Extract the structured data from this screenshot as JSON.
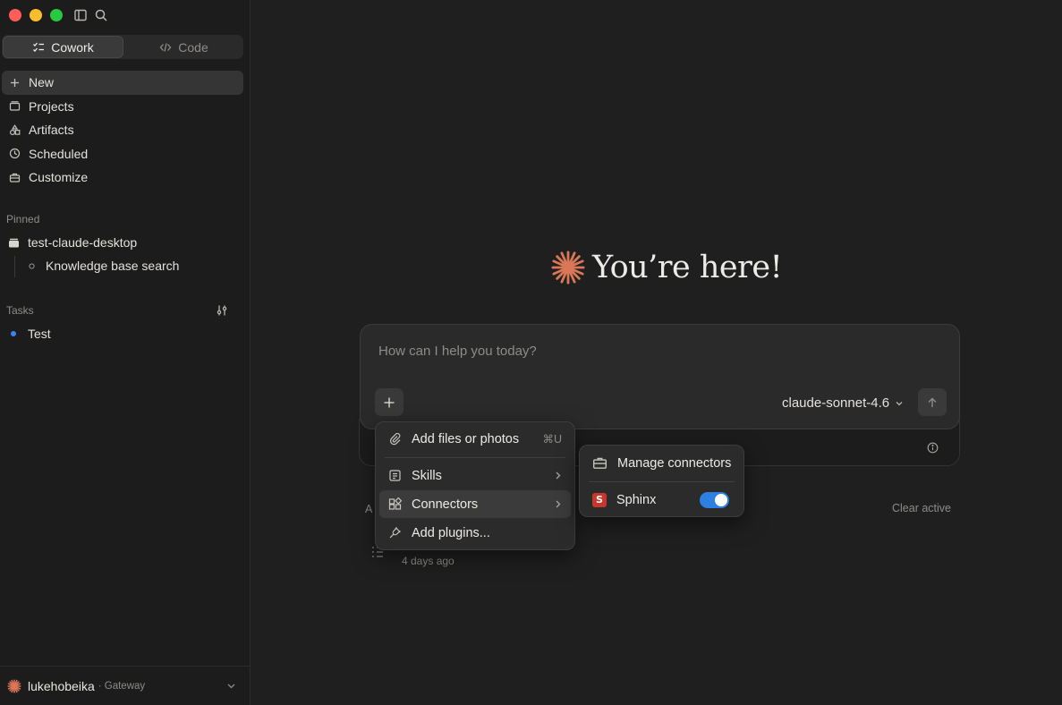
{
  "sidebar": {
    "modes": [
      {
        "label": "Cowork",
        "active": true
      },
      {
        "label": "Code",
        "active": false
      }
    ],
    "nav": [
      {
        "label": "New",
        "icon": "plus-icon"
      },
      {
        "label": "Projects",
        "icon": "folder-icon"
      },
      {
        "label": "Artifacts",
        "icon": "shapes-icon"
      },
      {
        "label": "Scheduled",
        "icon": "clock-icon"
      },
      {
        "label": "Customize",
        "icon": "briefcase-icon"
      }
    ],
    "pinned_label": "Pinned",
    "pinned": {
      "project": "test-claude-desktop",
      "child": "Knowledge base search"
    },
    "tasks_label": "Tasks",
    "tasks": [
      {
        "label": "Test",
        "status_color": "#3b82f6"
      }
    ],
    "account": {
      "name": "lukehobeika",
      "sub": "· Gateway"
    }
  },
  "main": {
    "greeting": "You’re here!",
    "accent_color": "#d97757",
    "composer": {
      "placeholder": "How can I help you today?",
      "model": "claude-sonnet-4.6"
    },
    "a_label": "A",
    "clear_active": "Clear active",
    "task_time": "4 days ago"
  },
  "menu": {
    "items": [
      {
        "label": "Add files or photos",
        "shortcut": "⌘U",
        "icon": "paperclip-icon"
      },
      {
        "label": "Skills",
        "icon": "skills-icon"
      },
      {
        "label": "Connectors",
        "icon": "connectors-icon",
        "highlighted": true
      },
      {
        "label": "Add plugins...",
        "icon": "plug-icon"
      }
    ]
  },
  "submenu": {
    "manage": "Manage connectors",
    "connector": {
      "label": "Sphinx",
      "logo_letter": "S",
      "logo_color": "#c9372c",
      "enabled": true
    }
  }
}
